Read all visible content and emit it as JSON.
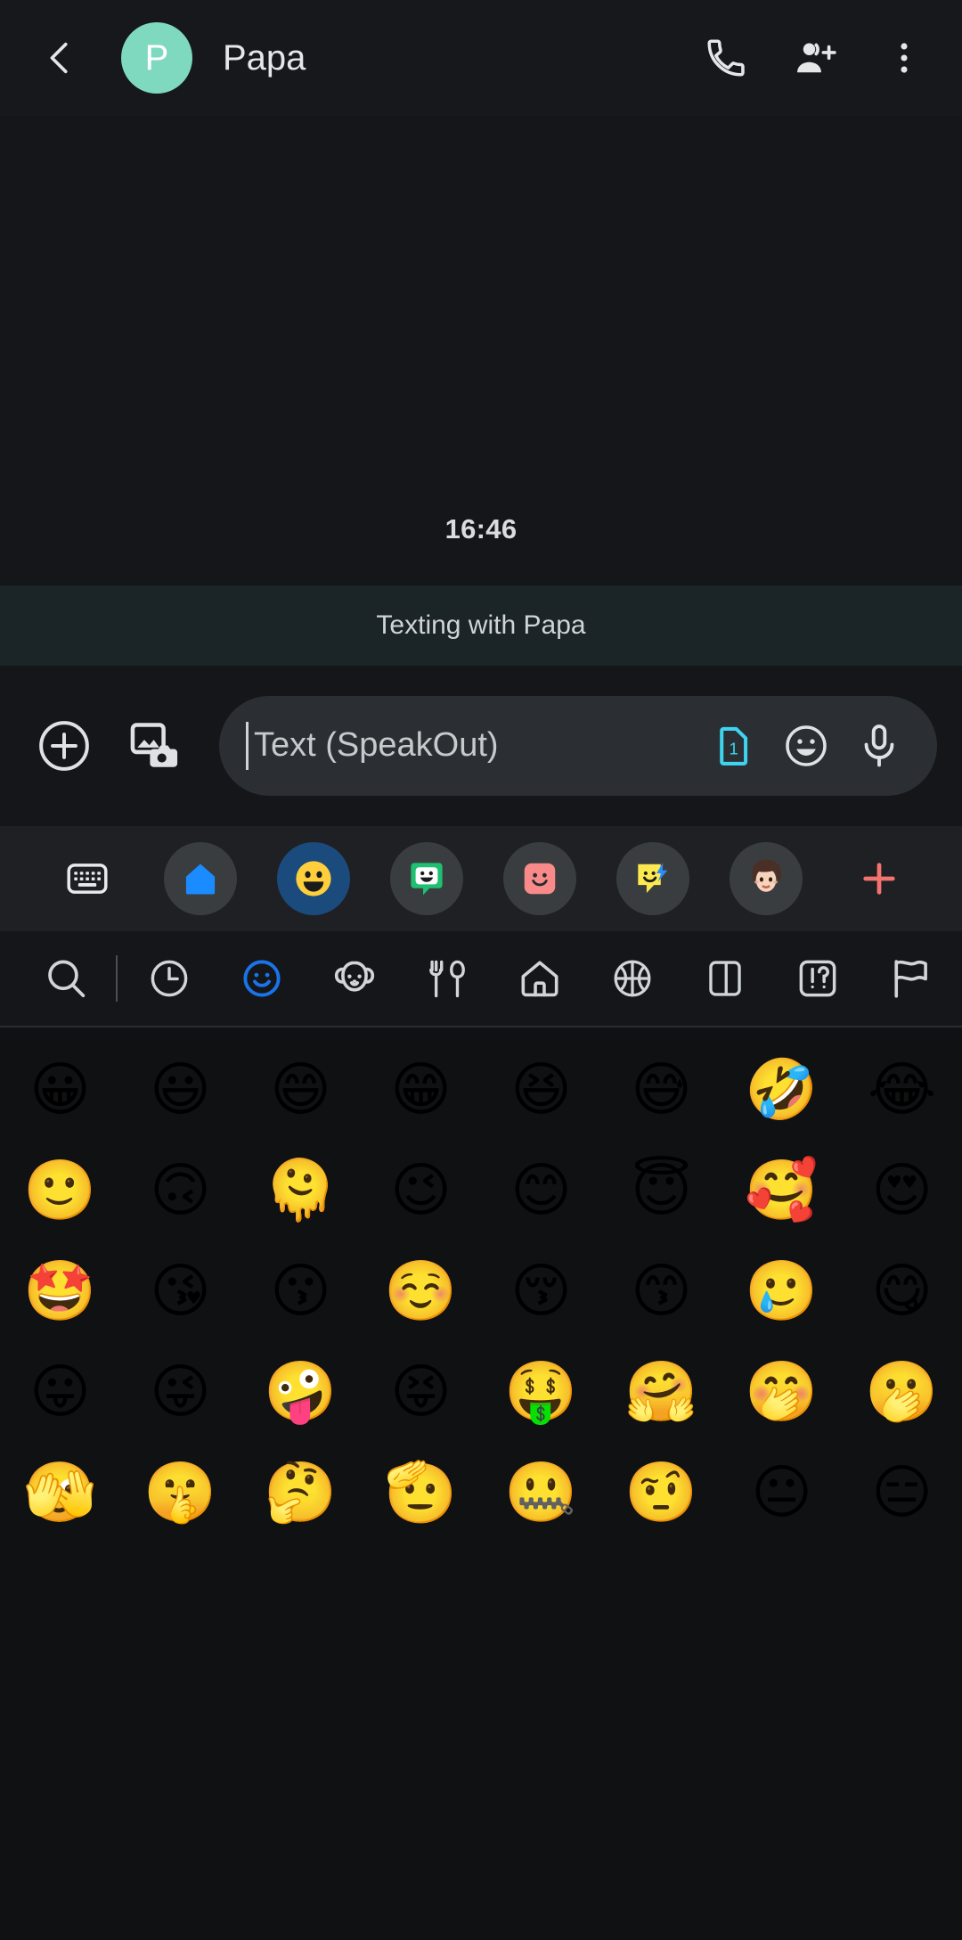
{
  "appbar": {
    "back_icon": "chevron-left-icon",
    "avatar_initial": "P",
    "avatar_color": "#7fd9be",
    "contact_name": "Papa",
    "actions": [
      {
        "name": "call-icon",
        "label": "Call"
      },
      {
        "name": "add-person-icon",
        "label": "Add people"
      },
      {
        "name": "overflow-menu-icon",
        "label": "More options"
      }
    ]
  },
  "conversation": {
    "timestamp": "16:46",
    "banner_text": "Texting with Papa"
  },
  "compose": {
    "plus_label": "Add attachment",
    "gallery_label": "Gallery and camera",
    "placeholder": "Text (SpeakOut)",
    "sim_badge": "1",
    "sim_color": "#3ed4f0",
    "emoji_label": "Emoji",
    "mic_label": "Voice message"
  },
  "app_row": {
    "items": [
      {
        "name": "keyboard-icon",
        "label": "Keyboard",
        "selected": false,
        "bg": "none"
      },
      {
        "name": "home-app-icon",
        "label": "Home",
        "selected": false,
        "bg": "#3a3d40"
      },
      {
        "name": "emoji-app-icon",
        "label": "Emoji",
        "selected": true,
        "bg": "#1b4a7d"
      },
      {
        "name": "sticker-app-icon",
        "label": "Stickers",
        "selected": false,
        "bg": "#3a3d40"
      },
      {
        "name": "pink-sticker-icon",
        "label": "Bitmoji",
        "selected": false,
        "bg": "#3a3d40"
      },
      {
        "name": "gif-sticker-icon",
        "label": "GIF",
        "selected": false,
        "bg": "#3a3d40"
      },
      {
        "name": "avatar-sticker-icon",
        "label": "Avatar",
        "selected": false,
        "bg": "#3a3d40"
      },
      {
        "name": "add-pack-icon",
        "label": "Add",
        "selected": false,
        "bg": "none"
      }
    ]
  },
  "emoji_categories": {
    "items": [
      {
        "name": "search-icon",
        "label": "Search",
        "selected": false
      },
      {
        "name": "recent-clock-icon",
        "label": "Recent",
        "selected": false
      },
      {
        "name": "smileys-icon",
        "label": "Smileys",
        "selected": true
      },
      {
        "name": "animals-icon",
        "label": "Animals",
        "selected": false
      },
      {
        "name": "food-icon",
        "label": "Food",
        "selected": false
      },
      {
        "name": "travel-icon",
        "label": "Travel",
        "selected": false
      },
      {
        "name": "activities-icon",
        "label": "Activities",
        "selected": false
      },
      {
        "name": "objects-icon",
        "label": "Objects",
        "selected": false
      },
      {
        "name": "symbols-icon",
        "label": "Symbols",
        "selected": false
      },
      {
        "name": "flags-icon",
        "label": "Flags",
        "selected": false
      }
    ],
    "selected_color": "#1a73e8"
  },
  "emoji_grid": {
    "columns": 8,
    "emojis": [
      "😀",
      "😃",
      "😄",
      "😁",
      "😆",
      "😅",
      "🤣",
      "😂",
      "🙂",
      "🙃",
      "🫠",
      "😉",
      "😊",
      "😇",
      "🥰",
      "😍",
      "🤩",
      "😘",
      "😗",
      "☺️",
      "😚",
      "😙",
      "🥲",
      "😋",
      "😛",
      "😜",
      "🤪",
      "😝",
      "🤑",
      "🤗",
      "🤭",
      "🫢",
      "🫣",
      "🤫",
      "🤔",
      "🫡",
      "🤐",
      "🤨",
      "😐",
      "😑"
    ]
  },
  "colors": {
    "page_bg": "#141619",
    "appbar_bg": "#16181b",
    "banner_bg": "#1b2426",
    "input_bg": "#2b2f33",
    "app_row_bg": "#1e2023",
    "grid_bg": "#0f1113"
  }
}
